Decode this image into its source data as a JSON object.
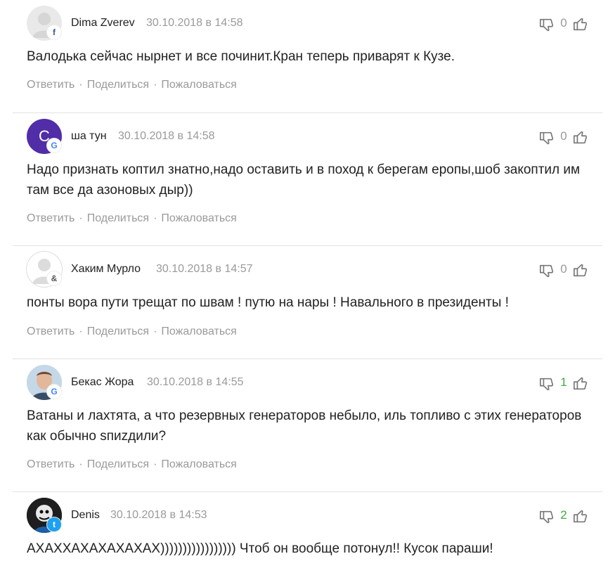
{
  "comments": [
    {
      "author": "Dima Zverev",
      "date": "30.10.2018 в 14:58",
      "text": "Валодька сейчас нырнет и все починит.Кран теперь приварят к Кузе.",
      "likes": "0",
      "avatar_type": "placeholder",
      "avatar_letter": "",
      "badge_glyph": "f",
      "badge_color": "#3b5998",
      "badge_bg": "#ffffff",
      "likes_color": "#9a9a9a"
    },
    {
      "author": "ша тун",
      "date": "30.10.2018 в 14:58",
      "text": "Надо признать коптил знатно,надо оставить и в поход к берегам еропы,шоб закоптил им там все да азоновых дыр))",
      "likes": "0",
      "avatar_type": "letter",
      "avatar_letter": "С",
      "avatar_color": "#512da8",
      "badge_glyph": "G",
      "badge_color": "#4285f4",
      "badge_bg": "#ffffff",
      "likes_color": "#9a9a9a"
    },
    {
      "author": "Хаким Мурло",
      "date": "30.10.2018 в 14:57",
      "text": "понты вора пути трещат по швам ! путю на нары ! Навального в президенты !",
      "likes": "0",
      "avatar_type": "placeholder",
      "avatar_letter": "",
      "badge_glyph": "&",
      "badge_color": "#555555",
      "badge_bg": "#ffffff",
      "likes_color": "#9a9a9a"
    },
    {
      "author": "Бекас Жора",
      "date": "30.10.2018 в 14:55",
      "text": "Ватаны и лахтята, а что резервных генераторов небыло, иль топливо с этих генераторов как обычно ѕпиzдили?",
      "likes": "1",
      "avatar_type": "photo",
      "avatar_letter": "",
      "badge_glyph": "G",
      "badge_color": "#4285f4",
      "badge_bg": "#ffffff",
      "likes_color": "#3cae3c"
    },
    {
      "author": "Denis",
      "date": "30.10.2018 в 14:53",
      "text": "АХАХХАХАХАХАХАХ))))))))))))))))) Чтоб он вообще потонул!! Кусок параши!",
      "likes": "2",
      "avatar_type": "photo-dark",
      "avatar_letter": "",
      "badge_glyph": "t",
      "badge_color": "#ffffff",
      "badge_bg": "#1da1f2",
      "likes_color": "#3cae3c"
    }
  ],
  "actions": {
    "reply": "Ответить",
    "share": "Поделиться",
    "report": "Пожаловаться",
    "separator": "·"
  }
}
